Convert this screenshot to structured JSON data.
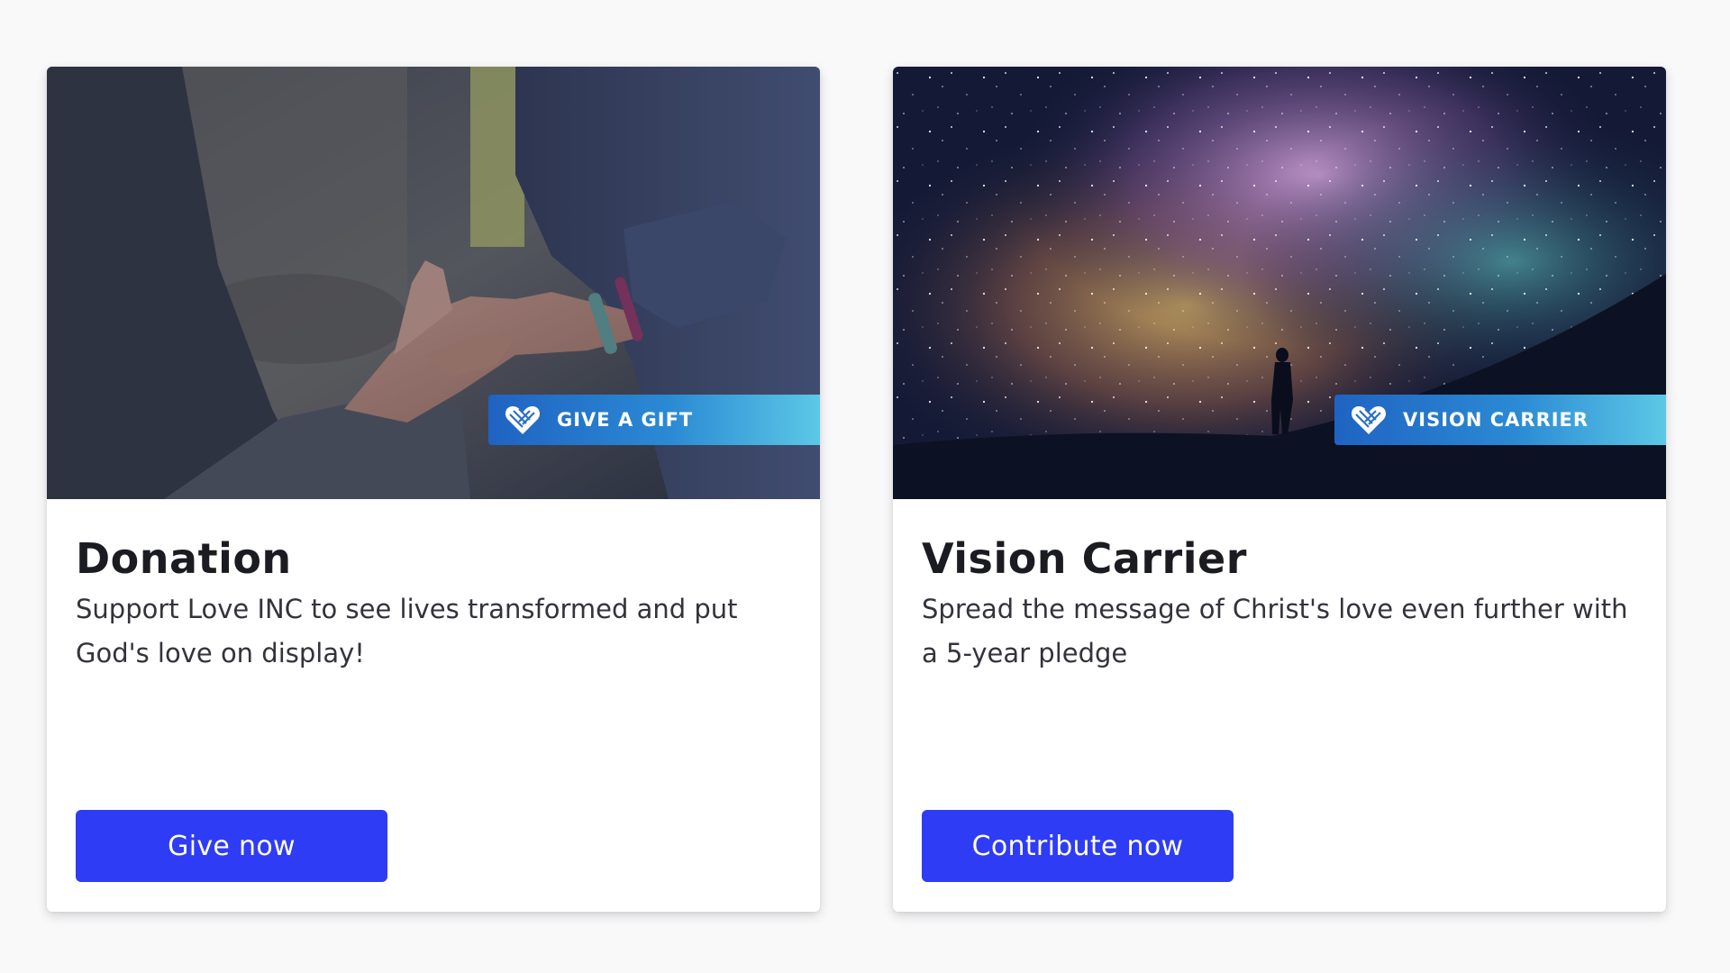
{
  "cards": [
    {
      "title": "Donation",
      "description": "Support Love INC to see lives transformed and put God's love on display!",
      "badge": {
        "label": "GIVE A GIFT",
        "icon": "heart-stripes-icon"
      },
      "button_label": "Give now",
      "image": "helping-hands-photo"
    },
    {
      "title": "Vision Carrier",
      "description": "Spread the message of Christ's love even further with a 5-year pledge",
      "badge": {
        "label": "VISION CARRIER",
        "icon": "heart-stripes-icon"
      },
      "button_label": "Contribute now",
      "image": "milky-way-silhouette-photo"
    }
  ],
  "colors": {
    "page_background": "#f9f9fa",
    "button": "#2e3cf5",
    "badge_gradient_start": "#1f63c2",
    "badge_gradient_end": "#5cc8e6",
    "title_text": "#1b1b22",
    "body_text": "#33333b"
  }
}
